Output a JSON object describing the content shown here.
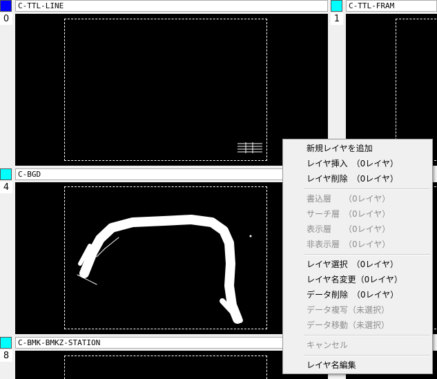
{
  "layers": [
    {
      "number": "0",
      "name": "C-TTL-LINE",
      "color": "#0000ff"
    },
    {
      "number": "1",
      "name": "C-TTL-FRAM",
      "color": "#00ffff"
    },
    {
      "number": "4",
      "name": "C-BGD",
      "color": "#00ffff"
    },
    {
      "number": "8",
      "name": "C-BMK-BMKZ-STATION",
      "color": "#00ffff"
    }
  ],
  "context_menu": {
    "items": [
      {
        "label": "新規レイヤを追加",
        "enabled": true
      },
      {
        "label": "レイヤ挿入　（0レイヤ）",
        "enabled": true
      },
      {
        "label": "レイヤ削除　（0レイヤ）",
        "enabled": true
      },
      {
        "label": "書込層　　（0レイヤ）",
        "enabled": false
      },
      {
        "label": "サーチ層　（0レイヤ）",
        "enabled": false
      },
      {
        "label": "表示層　　（0レイヤ）",
        "enabled": false
      },
      {
        "label": "非表示層　（0レイヤ）",
        "enabled": false
      },
      {
        "label": "レイヤ選択　（0レイヤ）",
        "enabled": true
      },
      {
        "label": "レイヤ名変更（0レイヤ）",
        "enabled": true
      },
      {
        "label": "データ削除　（0レイヤ）",
        "enabled": true
      },
      {
        "label": "データ複写（未選択）",
        "enabled": false
      },
      {
        "label": "データ移動（未選択）",
        "enabled": false
      },
      {
        "label": "キャンセル",
        "enabled": false
      },
      {
        "label": "レイヤ名編集",
        "enabled": true
      }
    ]
  }
}
